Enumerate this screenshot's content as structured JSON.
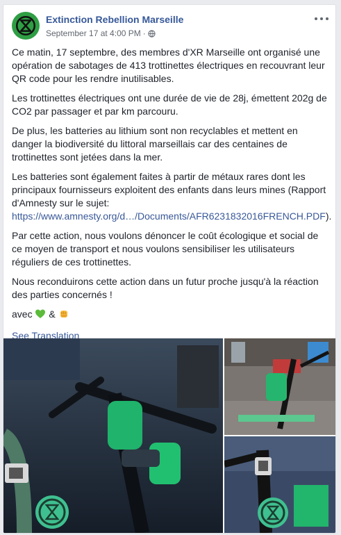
{
  "post": {
    "author": "Extinction Rebellion Marseille",
    "timestamp": "September 17 at 4:00 PM",
    "separator": "·",
    "paragraphs": {
      "p1": "Ce matin, 17 septembre, des membres d'XR Marseille ont organisé une opération de sabotages de 413 trottinettes électriques en recouvrant leur QR code pour les rendre inutilisables.",
      "p2": "Les trottinettes électriques ont une durée de vie de 28j, émettent 202g de CO2 par passager et par km parcouru.",
      "p3": "De plus, les batteries au lithium sont non recyclables et mettent en danger la biodiversité du littoral marseillais car des centaines de trottinettes sont jetées dans la mer.",
      "p4_before": "Les batteries sont également faites à partir de métaux rares dont les principaux fournisseurs exploitent des enfants dans leurs mines (Rapport d'Amnesty sur le sujet: ",
      "p4_link": "https://www.amnesty.org/d…/Documents/AFR6231832016FRENCH.PDF",
      "p4_after": ").",
      "p5": "Par cette action, nous voulons dénoncer le coût écologique et social de ce moyen de transport et nous voulons sensibiliser les utilisateurs réguliers de ces trottinettes.",
      "p6": "Nous reconduirons cette action dans un futur proche jusqu'à la réaction des parties concernés !",
      "p7_before": "avec",
      "p7_middle": "&"
    },
    "see_translation": "See Translation"
  },
  "icons": {
    "avatar": "extinction-rebellion-logo",
    "globe": "globe-icon",
    "more": "more-options-icon",
    "emoji1": "green-heart-emoji",
    "emoji2": "raised-fist-emoji"
  },
  "colors": {
    "link": "#385898",
    "name": "#365899",
    "text": "#1d2129",
    "meta": "#616770",
    "xr_green": "#2f9e44"
  }
}
